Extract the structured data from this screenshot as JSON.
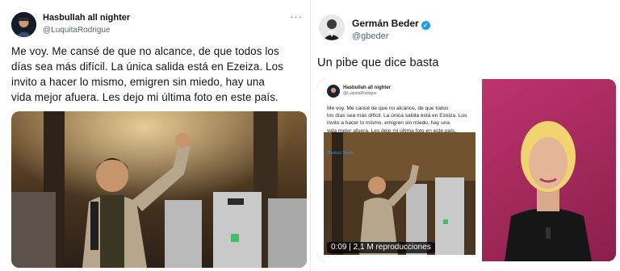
{
  "left_tweet": {
    "display_name": "Hasbullah all nighter",
    "handle": "@LuquitaRodrigue",
    "more_icon": "more-horizontal-icon",
    "text_lines": [
      "Me voy. Me cansé de que no alcance, de que todos los",
      "días sea más difícil. La única salida está en Ezeiza. Los",
      "invito a hacer lo mismo, emigren sin miedo, hay una",
      "vida mejor afuera. Les dejo mi última foto en este país."
    ]
  },
  "right_tweet": {
    "display_name": "Germán Beder",
    "handle": "@gbeder",
    "verified_icon": "verified-badge-icon",
    "text": "Un pibe que dice basta",
    "video": {
      "embedded_tweet": {
        "display_name": "Hasbullah all nighter",
        "handle": "@LuquitaRodrigue",
        "text_lines": [
          "Me voy. Me cansé de que no alcance, de que todos",
          "los días sea más difícil. La única salida está en Ezeiza. Los",
          "invito a hacer lo mismo, emigren sin miedo, hay una",
          "vida mejor afuera. Les dejo mi última foto en este país."
        ],
        "translate_label": "Traducir Tweet"
      },
      "duration": "0:09",
      "views": "2,1 M reproducciones"
    }
  },
  "colors": {
    "text": "#0f1419",
    "secondary": "#536471",
    "verified": "#1d9bf0",
    "studio_pink": "#c2366e"
  }
}
